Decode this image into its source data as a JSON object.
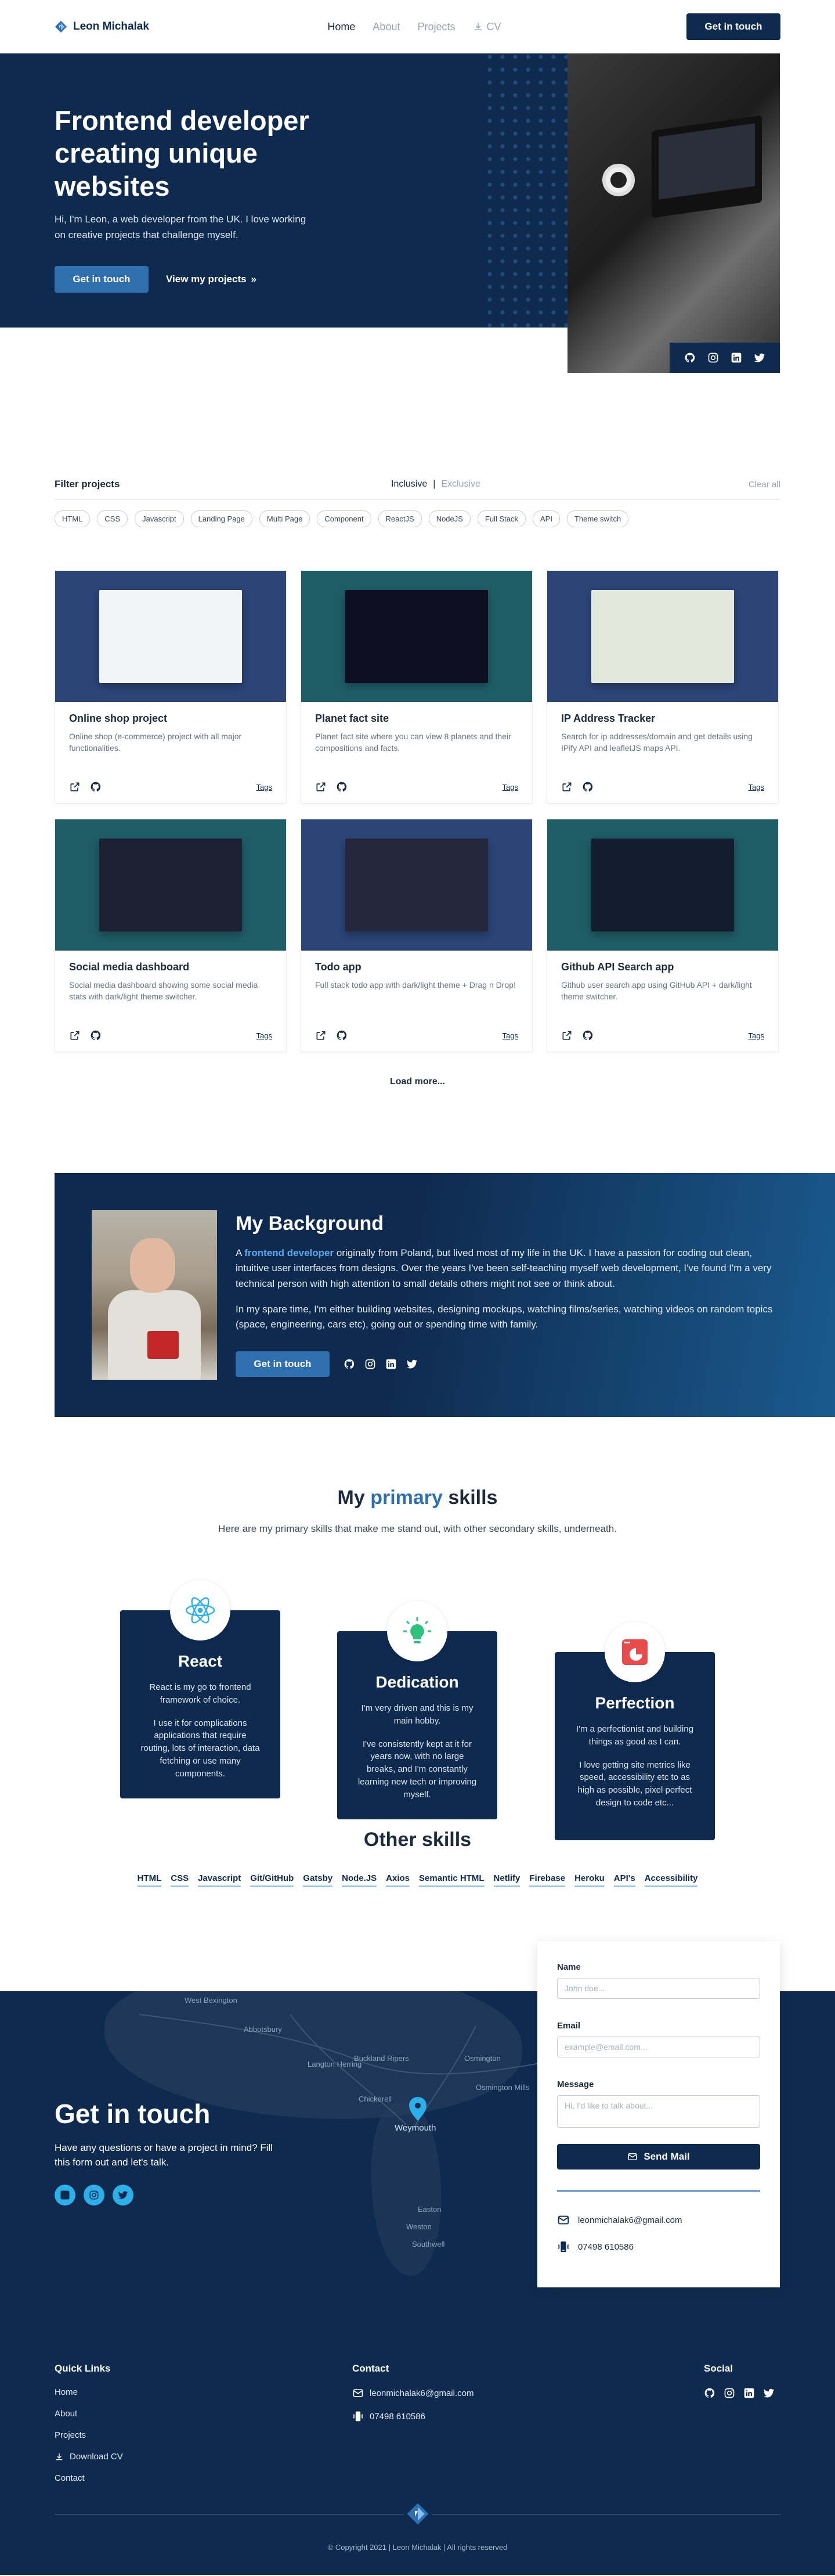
{
  "nav": {
    "brand": "Leon Michalak",
    "links": [
      "Home",
      "About",
      "Projects",
      "CV"
    ],
    "cta": "Get in touch"
  },
  "hero": {
    "title": "Frontend developer creating unique websites",
    "intro": "Hi, I'm Leon, a web developer from the UK. I love working on creative projects that challenge myself.",
    "primary_button": "Get in touch",
    "secondary_link": "View my projects"
  },
  "filter": {
    "title": "Filter projects",
    "toggle": [
      "Inclusive",
      "Exclusive"
    ],
    "clear": "Clear all",
    "tags": [
      "HTML",
      "CSS",
      "Javascript",
      "Landing Page",
      "Multi Page",
      "Component",
      "ReactJS",
      "NodeJS",
      "Full Stack",
      "API",
      "Theme switch"
    ]
  },
  "projects": [
    {
      "title": "Online shop project",
      "desc": "Online shop (e-commerce) project with all major functionalities.",
      "tags_label": "Tags",
      "bg": "#2c4478",
      "shot": "#f2f3f5"
    },
    {
      "title": "Planet fact site",
      "desc": "Planet fact site where you can view 8 planets and their compositions and facts.",
      "tags_label": "Tags",
      "bg": "#1f5d66",
      "shot": "#0e0f22"
    },
    {
      "title": "IP Address Tracker",
      "desc": "Search for ip addresses/domain and get details using IPify API and leafletJS maps API.",
      "tags_label": "Tags",
      "bg": "#2c4478",
      "shot": "#e4e8dc"
    },
    {
      "title": "Social media dashboard",
      "desc": "Social media dashboard showing some social media stats with dark/light theme switcher.",
      "tags_label": "Tags",
      "bg": "#1f5d66",
      "shot": "#1c2133"
    },
    {
      "title": "Todo app",
      "desc": "Full stack todo app with dark/light theme + Drag n Drop!",
      "tags_label": "Tags",
      "bg": "#2c4478",
      "shot": "#25273c"
    },
    {
      "title": "Github API Search app",
      "desc": "Github user search app using GitHub API + dark/light theme switcher.",
      "tags_label": "Tags",
      "bg": "#1f5d66",
      "shot": "#141d2f"
    }
  ],
  "load_more": "Load more...",
  "background": {
    "title": "My Background",
    "p1_before": "A ",
    "p1_highlight": "frontend developer",
    "p1_after": " originally from Poland, but lived most of my life in the UK. I have a passion for coding out clean, intuitive user interfaces from designs. Over the years I've been self-teaching myself web development, I've found I'm a very technical person with high attention to small details others might not see or think about.",
    "p2": "In my spare time, I'm either building websites, designing mockups, watching films/series, watching videos on random topics (space, engineering, cars etc), going out or spending time with family.",
    "button": "Get in touch"
  },
  "skills": {
    "title_before": "My ",
    "title_highlight": "primary",
    "title_after": " skills",
    "subtitle": "Here are my primary skills that make me stand out, with other secondary skills, underneath.",
    "items": [
      {
        "name": "React",
        "p1": "React is my go to frontend framework of choice.",
        "p2": "I use it for complications applications that require routing, lots of interaction, data fetching or use many components.",
        "icon": "react-icon"
      },
      {
        "name": "Dedication",
        "p1": "I'm very driven and this is my main hobby.",
        "p2": "I've consistently kept at it for years now, with no large breaks, and I'm constantly learning new tech or improving myself.",
        "icon": "lightbulb-icon"
      },
      {
        "name": "Perfection",
        "p1": "I'm a perfectionist and building things as good as I can.",
        "p2": "I love getting site metrics like speed, accessibility etc to as high as possible, pixel perfect design to code etc...",
        "icon": "pie-chart-icon"
      }
    ],
    "other_title": "Other skills",
    "other": [
      "HTML",
      "CSS",
      "Javascript",
      "Git/GitHub",
      "Gatsby",
      "Node.JS",
      "Axios",
      "Semantic HTML",
      "Netlify",
      "Firebase",
      "Heroku",
      "API's",
      "Accessibility"
    ]
  },
  "contact": {
    "title": "Get in touch",
    "text": "Have any questions or have a project in mind? Fill this form out and let's talk.",
    "form": {
      "name_label": "Name",
      "name_placeholder": "John doe...",
      "email_label": "Email",
      "email_placeholder": "example@email.com...",
      "message_label": "Message",
      "message_placeholder": "Hi, I'd like to talk about...",
      "send": "Send Mail",
      "email": "leonmichalak6@gmail.com",
      "phone": "07498 610586"
    },
    "map_labels": [
      "West Bexington",
      "Abbotsbury",
      "Langton Herring",
      "Buckland Ripers",
      "Osmington",
      "Chickerell",
      "Weymouth",
      "Osmington Mills",
      "Easton",
      "Weston",
      "Southwell"
    ]
  },
  "footer": {
    "quick_title": "Quick Links",
    "quick_links": [
      "Home",
      "About",
      "Projects",
      "Download CV",
      "Contact"
    ],
    "contact_title": "Contact",
    "email": "leonmichalak6@gmail.com",
    "phone": "07498 610586",
    "social_title": "Social",
    "copyright": "© Copyright 2021 | Leon Michalak | All rights reserved"
  },
  "colors": {
    "navy": "#0f2a4f",
    "accent": "#2f6fb0",
    "light_accent": "#2db0ea"
  }
}
